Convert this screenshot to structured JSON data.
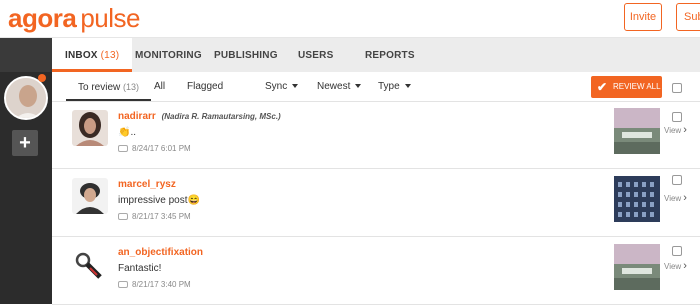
{
  "header": {
    "logo_primary": "agora",
    "logo_secondary": "pulse",
    "invite_label": "Invite",
    "subscribe_label": "Sub"
  },
  "nav": {
    "tabs": [
      {
        "label": "INBOX",
        "count": "(13)"
      },
      {
        "label": "MONITORING"
      },
      {
        "label": "PUBLISHING"
      },
      {
        "label": "USERS"
      },
      {
        "label": "REPORTS"
      }
    ]
  },
  "filters": {
    "to_review": "To review",
    "to_review_count": "(13)",
    "all": "All",
    "flagged": "Flagged",
    "sync": "Sync",
    "newest": "Newest",
    "type": "Type",
    "review_all": "REVIEW ALL"
  },
  "items": [
    {
      "username": "nadirarr",
      "fullname": "(Nadira R. Ramautarsing, MSc.)",
      "text": "👏..",
      "date": "8/24/17 6:01 PM",
      "view": "View"
    },
    {
      "username": "marcel_rysz",
      "fullname": "",
      "text": "impressive post😄",
      "date": "8/21/17 3:45 PM",
      "view": "View"
    },
    {
      "username": "an_objectifixation",
      "fullname": "",
      "text": "Fantastic!",
      "date": "8/21/17 3:40 PM",
      "view": "View"
    }
  ],
  "colors": {
    "accent": "#f26522",
    "sidebar": "#2c2c2c",
    "nav_bg": "#ececec"
  }
}
